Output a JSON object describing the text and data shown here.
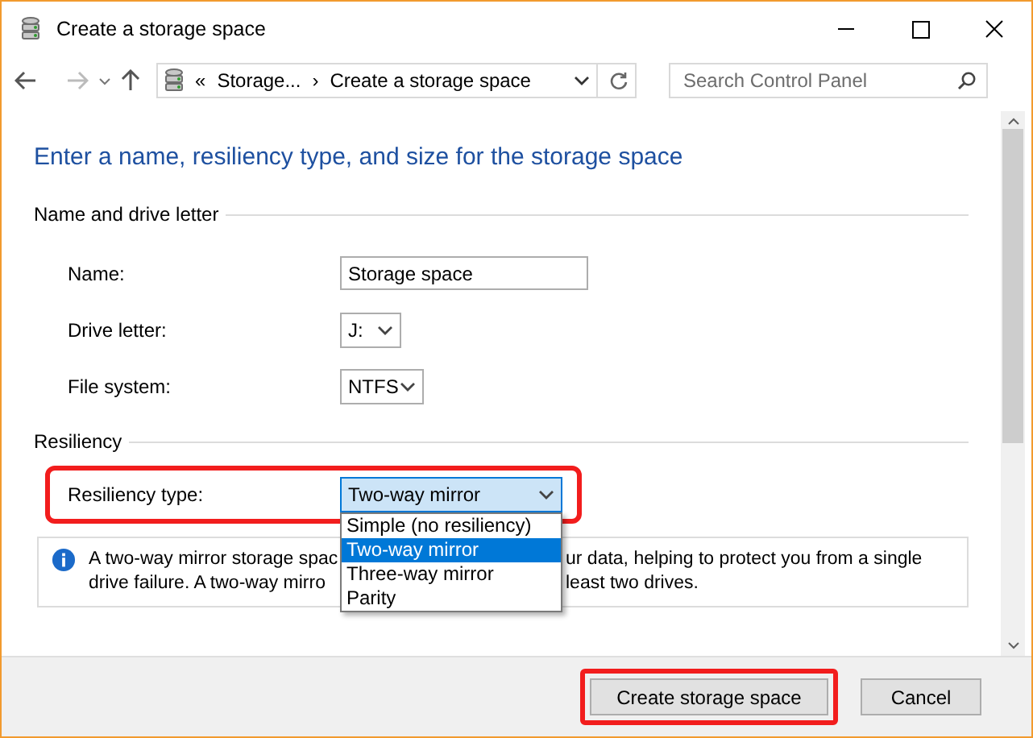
{
  "window": {
    "title": "Create a storage space"
  },
  "nav": {
    "breadcrumb": [
      {
        "label": "«"
      },
      {
        "label": "Storage..."
      },
      {
        "label": "›"
      },
      {
        "label": "Create a storage space"
      }
    ],
    "search": {
      "placeholder": "Search Control Panel"
    }
  },
  "heading": "Enter a name, resiliency type, and size for the storage space",
  "sections": [
    {
      "title": "Name and drive letter",
      "rows": [
        {
          "kind": "text",
          "label": "Name:",
          "value": "Storage space",
          "highlighted": false
        },
        {
          "kind": "select",
          "label": "Drive letter:",
          "value": "J:",
          "highlighted": false
        },
        {
          "kind": "select",
          "label": "File system:",
          "value": "NTFS",
          "highlighted": false
        }
      ]
    },
    {
      "title": "Resiliency",
      "rows": [
        {
          "kind": "select",
          "label": "Resiliency type:",
          "value": "Two-way mirror",
          "highlighted": true,
          "expanded": true,
          "options": [
            {
              "label": "Simple (no resiliency)",
              "selected": false
            },
            {
              "label": "Two-way mirror",
              "selected": true
            },
            {
              "label": "Three-way mirror",
              "selected": false
            },
            {
              "label": "Parity",
              "selected": false
            }
          ]
        }
      ]
    }
  ],
  "info": {
    "lines": [
      [
        "A two-way mirror storage spac",
        "ur data, helping to protect you from a single"
      ],
      [
        "drive failure. A two-way mirro",
        "least two drives."
      ]
    ]
  },
  "buttons": [
    {
      "label": "Create storage space",
      "highlighted": true
    },
    {
      "label": "Cancel",
      "highlighted": false
    }
  ]
}
